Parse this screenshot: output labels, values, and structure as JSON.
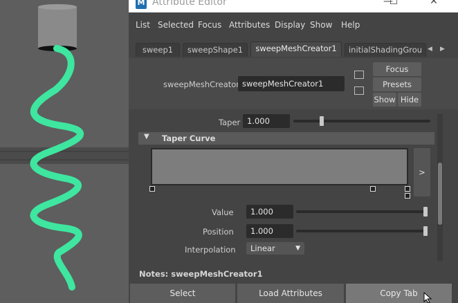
{
  "window": {
    "title": "Attribute Editor",
    "logo": "M"
  },
  "window_controls": {
    "minimize": "—",
    "maximize": "☐",
    "close": "✕"
  },
  "menu": [
    "List",
    "Selected",
    "Focus",
    "Attributes",
    "Display",
    "Show",
    "Help"
  ],
  "tabs": [
    "sweep1",
    "sweepShape1",
    "sweepMeshCreator1",
    "initialShadingGrou"
  ],
  "tab_arrows": {
    "left": "◀",
    "right": "▶"
  },
  "node": {
    "label": "sweepMeshCreator:",
    "value": "sweepMeshCreator1",
    "buttons": {
      "focus": "Focus",
      "presets": "Presets",
      "show": "Show",
      "hide": "Hide"
    }
  },
  "attributes": {
    "taper": {
      "label": "Taper",
      "value": "1.000",
      "level": 0.2
    },
    "taper_curve": {
      "header": "Taper Curve",
      "expand": ">",
      "value": {
        "label": "Value",
        "value": "1.000",
        "level": 1.0
      },
      "position": {
        "label": "Position",
        "value": "1.000",
        "level": 1.0
      },
      "interpolation": {
        "label": "Interpolation",
        "value": "Linear"
      }
    }
  },
  "notes": {
    "text": "Notes:  sweepMeshCreator1"
  },
  "bottom_buttons": [
    "Select",
    "Load Attributes",
    "Copy Tab"
  ],
  "colors": {
    "spiral": "#3ee6a0",
    "cylinder": "#8a8a8a",
    "panel_bg": "#444444",
    "field_bg": "#2b2b2b"
  }
}
